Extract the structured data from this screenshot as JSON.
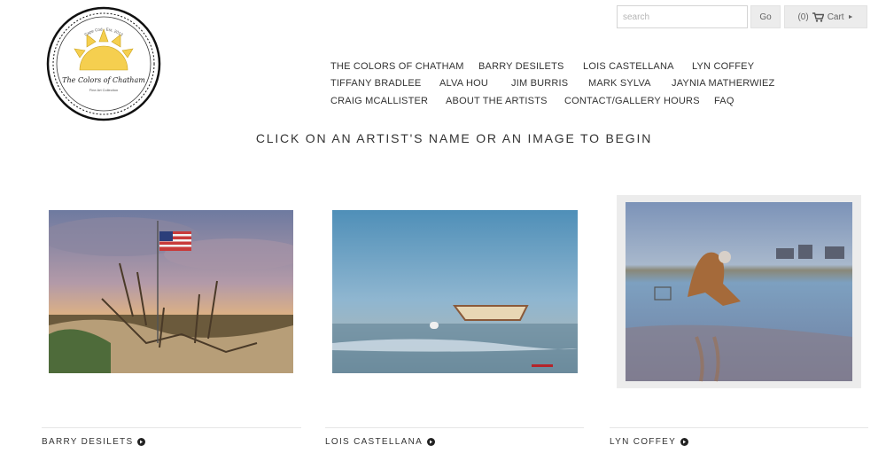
{
  "logo": {
    "top_text": "Cape Cod · Est. 2013",
    "script_text": "The Colors of Chatham",
    "sub_text": "Fine Art Collection"
  },
  "search": {
    "placeholder": "search",
    "go_label": "Go"
  },
  "cart": {
    "count": "(0)",
    "label": "Cart"
  },
  "nav": {
    "items": [
      "THE COLORS OF CHATHAM",
      "BARRY DESILETS",
      "LOIS CASTELLANA",
      "LYN COFFEY",
      "TIFFANY BRADLEE",
      "ALVA HOU",
      "JIM BURRIS",
      "MARK SYLVA",
      "JAYNIA MATHERWIEZ",
      "CRAIG MCALLISTER",
      "ABOUT THE ARTISTS",
      "CONTACT/GALLERY HOURS",
      "FAQ"
    ]
  },
  "heading": "CLICK ON AN ARTIST'S NAME OR AN IMAGE TO BEGIN",
  "artists": [
    {
      "name": "BARRY DESILETS",
      "image": "beach-dunes-with-american-flag"
    },
    {
      "name": "LOIS CASTELLANA",
      "image": "dory-boat-at-low-tide"
    },
    {
      "name": "LYN COFFEY",
      "image": "clammer-on-tidal-flats"
    }
  ],
  "colors": {
    "text": "#333333",
    "button_bg": "#ececec",
    "rule": "#e6e6e6"
  }
}
